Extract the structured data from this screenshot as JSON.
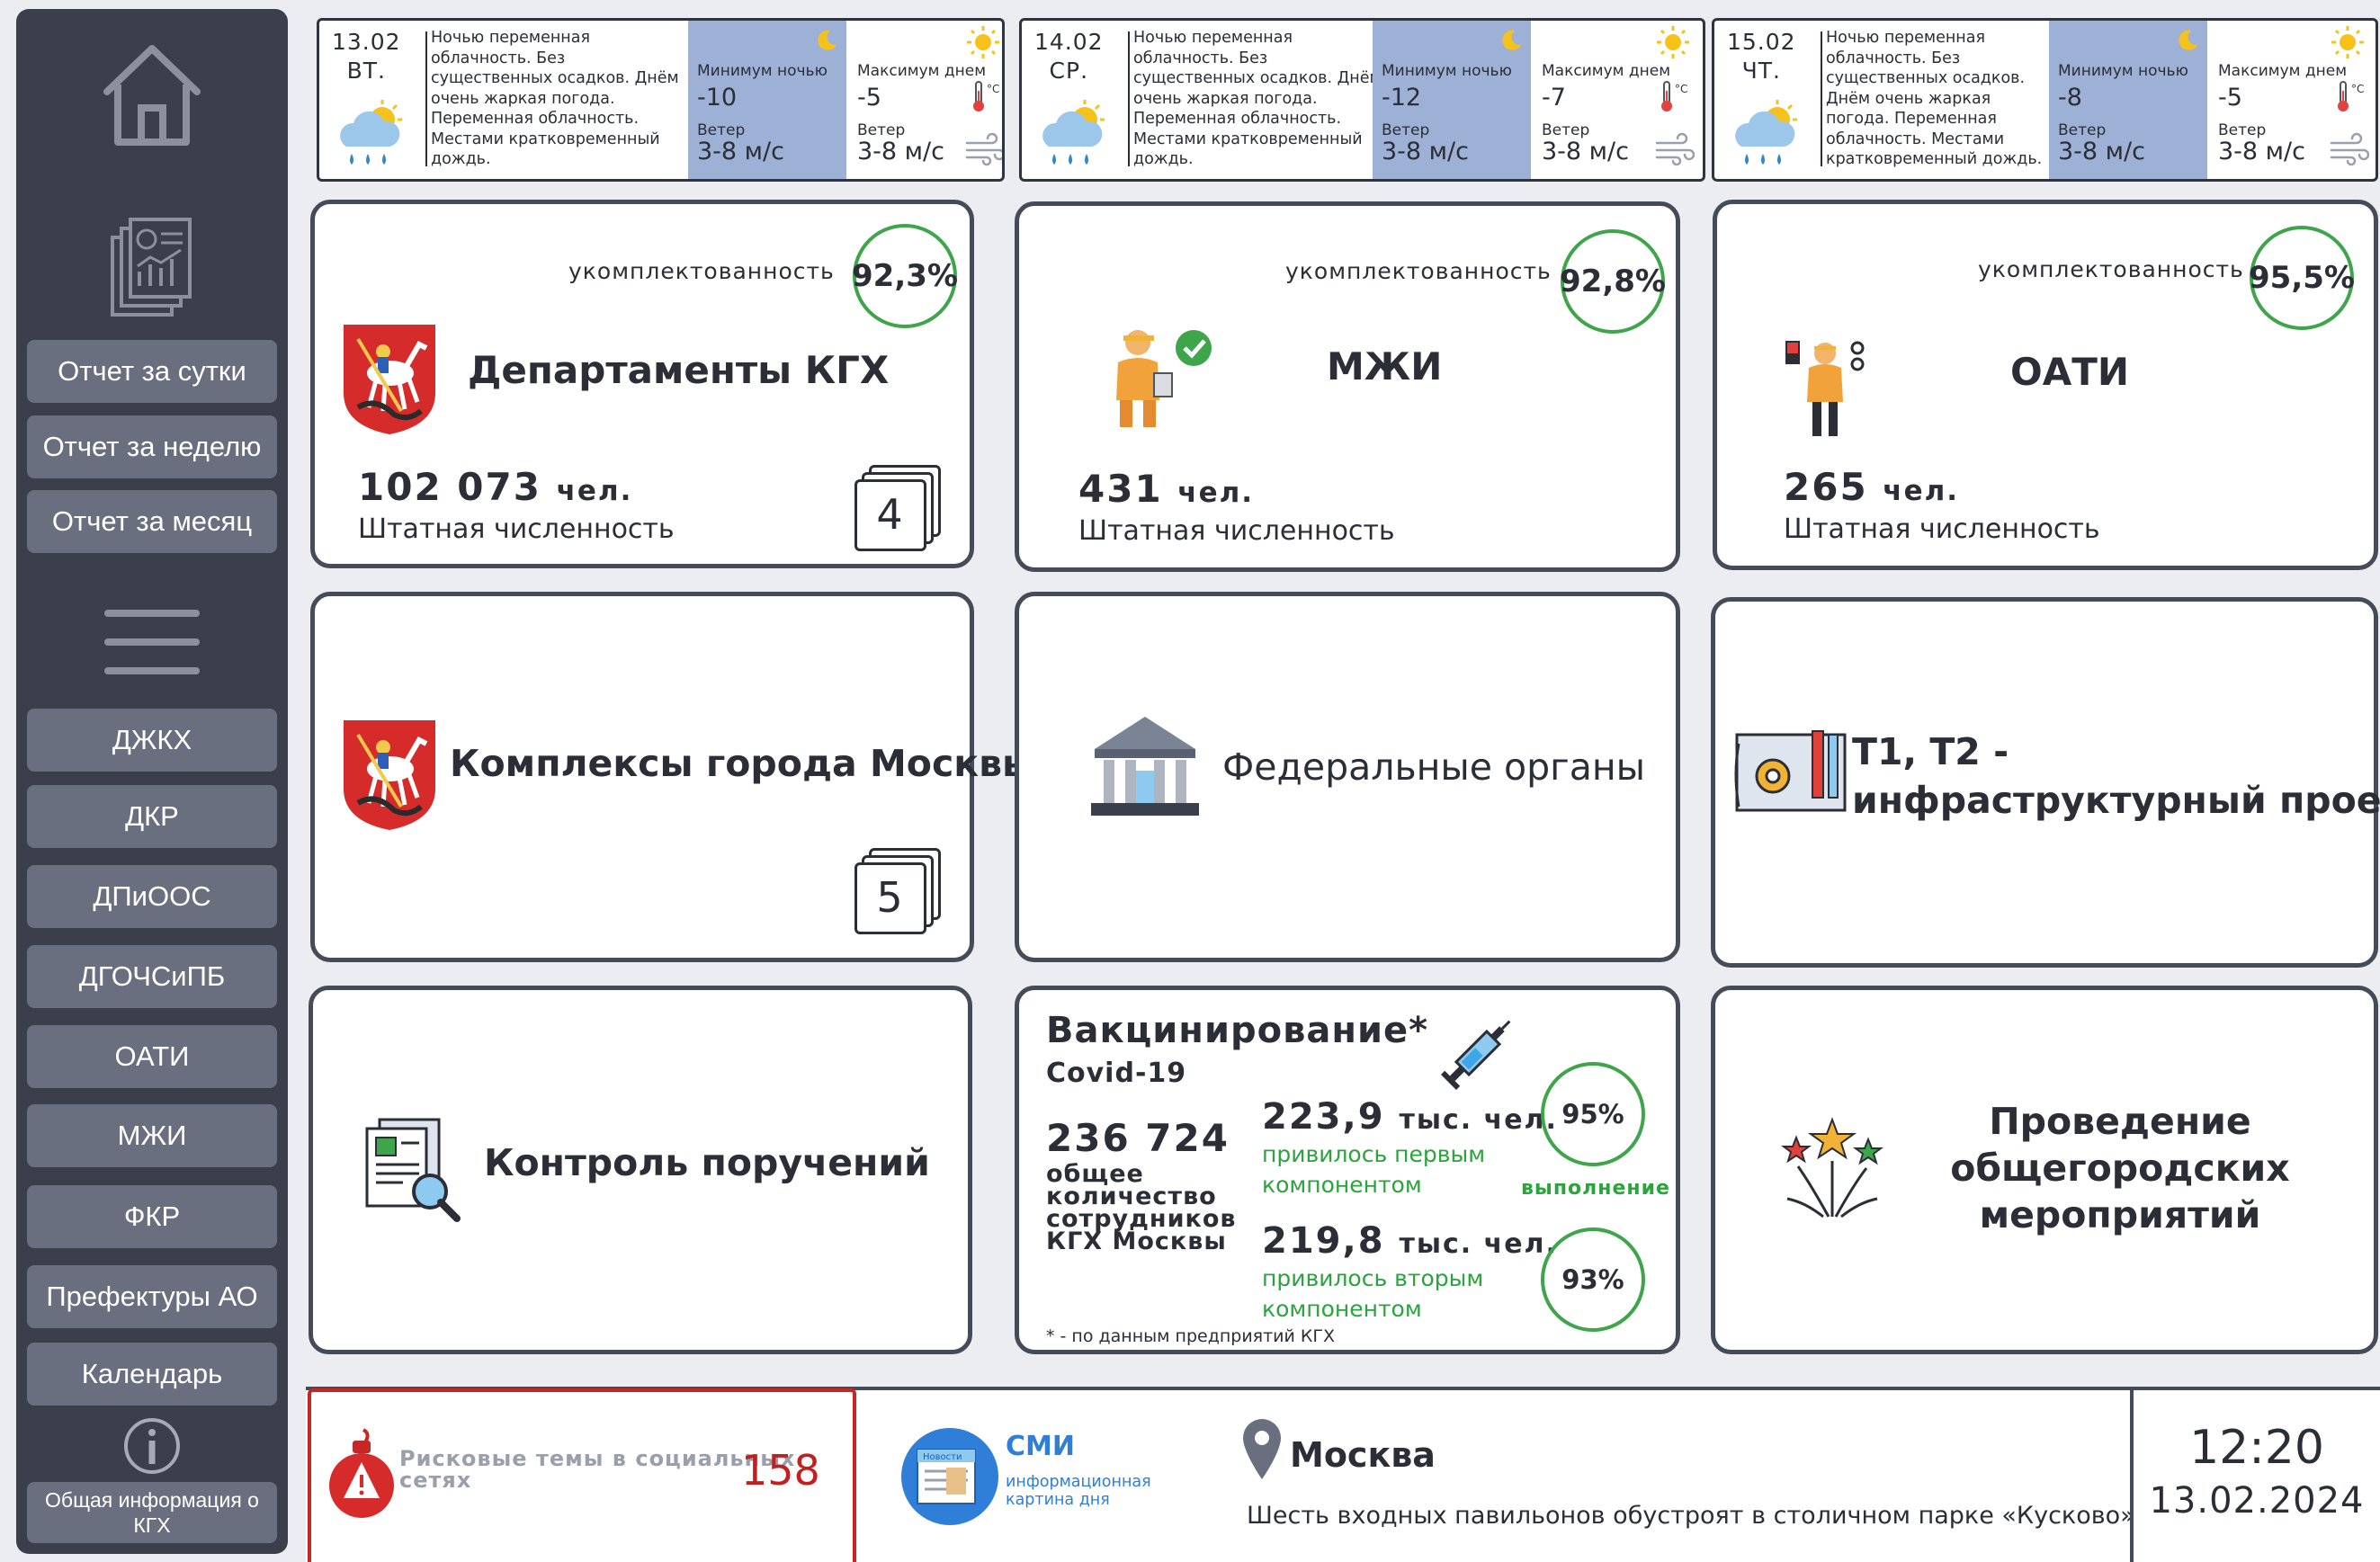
{
  "sidebar": {
    "report_buttons": [
      "Отчет за сутки",
      "Отчет за неделю",
      "Отчет за месяц"
    ],
    "nav_items": [
      "ДЖКХ",
      "ДКР",
      "ДПиООС",
      "ДГОЧСиПБ",
      "ОАТИ",
      "МЖИ",
      "ФКР",
      "Префектуры АО",
      "Календарь"
    ],
    "info_label": "Общая информация о КГХ"
  },
  "weather": [
    {
      "date": "13.02",
      "weekday": "ВТ.",
      "description": "Ночью переменная облачность. Без существенных осадков. Днём очень жаркая погода. Переменная облачность. Местами кратковременный дождь.",
      "min_label": "Минимум ночью",
      "min_value": "-10",
      "max_label": "Максимум днем",
      "max_value": "-5",
      "wind_label": "Ветер",
      "wind_night": "3-8 м/с",
      "wind_day": "3-8 м/с"
    },
    {
      "date": "14.02",
      "weekday": "СР.",
      "description": "Ночью переменная облачность. Без существенных осадков. Днём очень жаркая погода. Переменная облачность. Местами кратковременный дождь.",
      "min_label": "Минимум ночью",
      "min_value": "-12",
      "max_label": "Максимум днем",
      "max_value": "-7",
      "wind_label": "Ветер",
      "wind_night": "3-8 м/с",
      "wind_day": "3-8 м/с"
    },
    {
      "date": "15.02",
      "weekday": "ЧТ.",
      "description": "Ночью переменная облачность. Без существенных осадков. Днём очень жаркая погода. Переменная облачность. Местами кратковременный дождь.",
      "min_label": "Минимум ночью",
      "min_value": "-8",
      "max_label": "Максимум днем",
      "max_value": "-5",
      "wind_label": "Ветер",
      "wind_night": "3-8 м/с",
      "wind_day": "3-8 м/с"
    }
  ],
  "cards": {
    "completeness_label": "укомплектованность",
    "staff_label": "Штатная численность",
    "staff_unit": "чел.",
    "kgh": {
      "title": "Департаменты КГХ",
      "pct": "92,3%",
      "staff": "102 073",
      "count": "4"
    },
    "mzhi": {
      "title": "МЖИ",
      "pct": "92,8%",
      "staff": "431"
    },
    "oati": {
      "title": "ОАТИ",
      "pct": "95,5%",
      "staff": "265"
    },
    "complexes": {
      "title": "Комплексы города Москвы",
      "count": "5"
    },
    "federal": {
      "title": "Федеральные органы"
    },
    "t1t2": {
      "title_line1": "Т1, Т2 -",
      "title_line2": "инфраструктурный проект"
    },
    "control": {
      "title": "Контроль поручений"
    },
    "events": {
      "title_line1": "Проведение",
      "title_line2": "общегородских",
      "title_line3": "мероприятий"
    }
  },
  "vaccination": {
    "title": "Вакцинирование*",
    "subtitle": "Covid-19",
    "total": "236 724",
    "total_label": "общее количество сотрудников КГХ Москвы",
    "first_value": "223,9",
    "first_unit": "тыс. чел.",
    "first_note": "привилось первым компонентом",
    "first_pct": "95%",
    "execution_label": "выполнение",
    "second_value": "219,8",
    "second_unit": "тыс. чел.",
    "second_note": "привилось вторым компонентом",
    "second_pct": "93%",
    "footnote": "* - по данным предприятий КГХ"
  },
  "bottom": {
    "risk_label": "Рисковые темы в социальных сетях",
    "risk_count": "158",
    "smi_title": "СМИ",
    "smi_sub": "информационная картина дня",
    "news_icon_label": "Новости",
    "city": "Москва",
    "news_headline": "Шесть входных павильонов обустроят в столичном парке «Кусково»",
    "time": "12:20",
    "date": "13.02.2024"
  },
  "colors": {
    "sidebar_bg": "#3a3f4b",
    "sidebar_button": "#6a6f7f",
    "card_border": "#444b59",
    "accent_green": "#3ea54a",
    "weather_min_bg": "#9db1d6",
    "risk_red": "#c41f1f",
    "smi_blue": "#2f7ed8"
  }
}
